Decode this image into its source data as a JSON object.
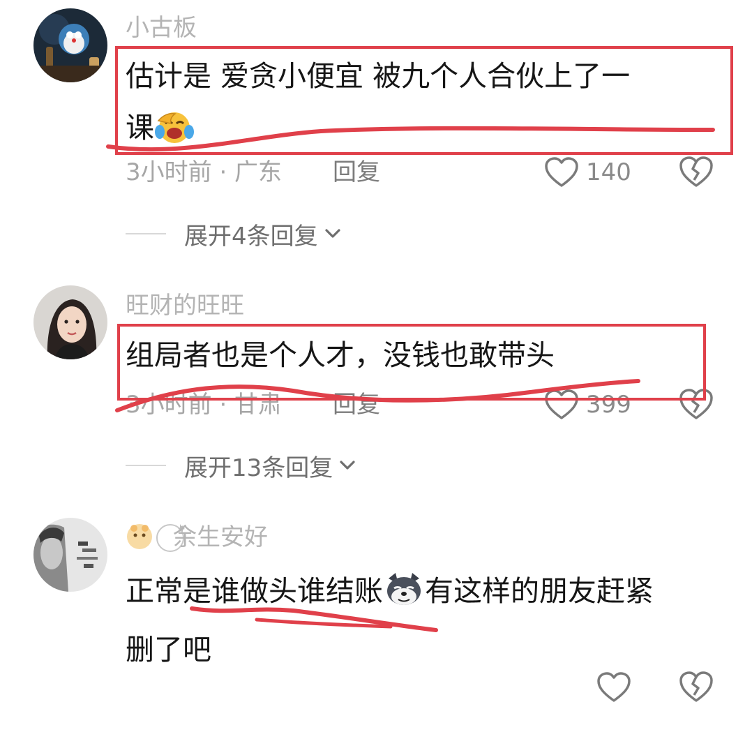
{
  "comments": [
    {
      "username": "小古板",
      "text_line1": "估计是  爱贪小便宜  被九个人合伙上了一",
      "text_line2": "课",
      "time_location": "3小时前 · 广东",
      "reply_label": "回复",
      "like_count": "140",
      "expand_label": "展开4条回复"
    },
    {
      "username": "旺财的旺旺",
      "text_line1": "组局者也是个人才，没钱也敢带头",
      "time_location": "3小时前 · 甘肃",
      "reply_label": "回复",
      "like_count": "399",
      "expand_label": "展开13条回复"
    },
    {
      "username": "余生安好",
      "text_line1_a": "正常是谁做头谁结账",
      "text_line1_b": "有这样的朋友赶紧",
      "text_line2": "删了吧"
    }
  ],
  "colors": {
    "annotation_red": "#e0404a",
    "username_gray": "#b4b4b4",
    "meta_gray": "#a6a6a6"
  },
  "icons": [
    "heart-outline-icon",
    "broken-heart-icon",
    "chevron-down-icon",
    "laughing-tears-emoji",
    "husky-dog-emoji"
  ]
}
